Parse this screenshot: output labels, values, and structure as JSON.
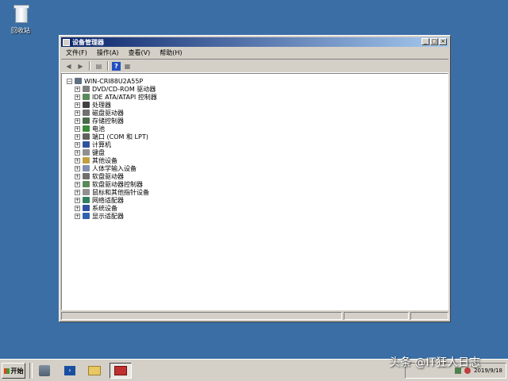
{
  "desktop": {
    "recycle_bin_label": "回收站"
  },
  "window": {
    "title": "设备管理器",
    "menu": [
      "文件(F)",
      "操作(A)",
      "查看(V)",
      "帮助(H)"
    ],
    "root": "WIN-CRI88U2A55P",
    "items": [
      {
        "label": "DVD/CD-ROM 驱动器",
        "icon": "dvd-drive-icon",
        "color": "#808080"
      },
      {
        "label": "IDE ATA/ATAPI 控制器",
        "icon": "ide-controller-icon",
        "color": "#5a8a5a"
      },
      {
        "label": "处理器",
        "icon": "processor-icon",
        "color": "#404040"
      },
      {
        "label": "磁盘驱动器",
        "icon": "disk-drive-icon",
        "color": "#707070"
      },
      {
        "label": "存储控制器",
        "icon": "storage-controller-icon",
        "color": "#4a6a4a"
      },
      {
        "label": "电池",
        "icon": "battery-icon",
        "color": "#3a8a3a"
      },
      {
        "label": "端口 (COM 和 LPT)",
        "icon": "port-icon",
        "color": "#606060"
      },
      {
        "label": "计算机",
        "icon": "computer-icon",
        "color": "#3050a0"
      },
      {
        "label": "键盘",
        "icon": "keyboard-icon",
        "color": "#909090"
      },
      {
        "label": "其他设备",
        "icon": "other-devices-icon",
        "color": "#c0a040"
      },
      {
        "label": "人体学输入设备",
        "icon": "hid-icon",
        "color": "#8090b0"
      },
      {
        "label": "软盘驱动器",
        "icon": "floppy-drive-icon",
        "color": "#707070"
      },
      {
        "label": "软盘驱动器控制器",
        "icon": "floppy-controller-icon",
        "color": "#5a8a5a"
      },
      {
        "label": "鼠标和其他指针设备",
        "icon": "mouse-icon",
        "color": "#909090"
      },
      {
        "label": "网络适配器",
        "icon": "network-adapter-icon",
        "color": "#308060"
      },
      {
        "label": "系统设备",
        "icon": "system-devices-icon",
        "color": "#3050a0"
      },
      {
        "label": "显示适配器",
        "icon": "display-adapter-icon",
        "color": "#3060b0"
      }
    ]
  },
  "taskbar": {
    "start_label": "开始",
    "clock": "2019/9/18"
  },
  "watermark": "头条 @IT狂人日志",
  "colors": {
    "desktop": "#3a6ea5",
    "title_active": "#0a246a",
    "chrome": "#d4d0c8"
  }
}
